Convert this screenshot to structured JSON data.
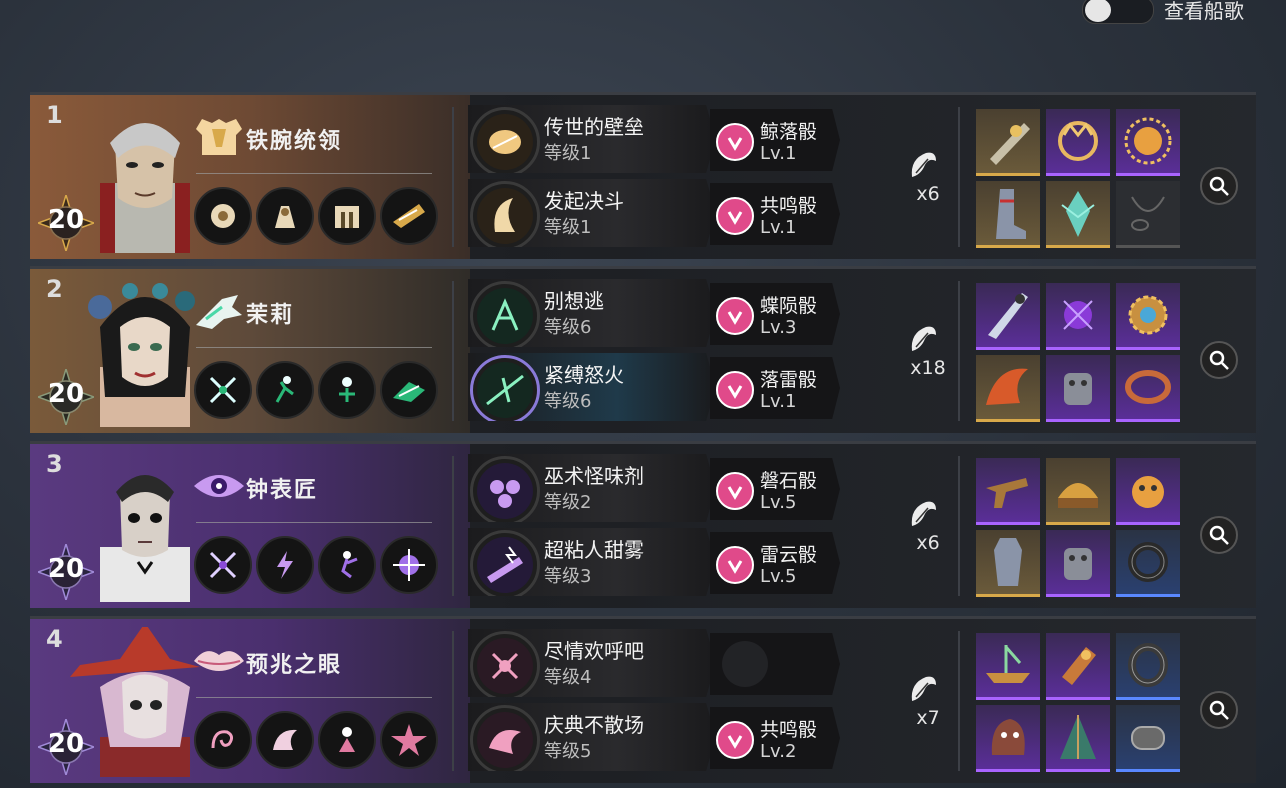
{
  "toggle": {
    "label": "查看船歌",
    "on": false
  },
  "rows": [
    {
      "rank": "1",
      "level": "20",
      "character": "铁腕统领",
      "theme": "brown",
      "skills": [
        {
          "name": "传世的壁垒",
          "level": "等级1"
        },
        {
          "name": "发起决斗",
          "level": "等级1"
        }
      ],
      "dice": [
        {
          "name": "鲸落骰",
          "level": "Lv.1"
        },
        {
          "name": "共鸣骰",
          "level": "Lv.1"
        }
      ],
      "count": "x6"
    },
    {
      "rank": "2",
      "level": "20",
      "character": "茉莉",
      "theme": "green",
      "skills": [
        {
          "name": "别想逃",
          "level": "等级6"
        },
        {
          "name": "紧缚怒火",
          "level": "等级6"
        }
      ],
      "dice": [
        {
          "name": "蝶陨骰",
          "level": "Lv.3"
        },
        {
          "name": "落雷骰",
          "level": "Lv.1"
        }
      ],
      "count": "x18"
    },
    {
      "rank": "3",
      "level": "20",
      "character": "钟表匠",
      "theme": "purple",
      "skills": [
        {
          "name": "巫术怪味剂",
          "level": "等级2"
        },
        {
          "name": "超粘人甜雾",
          "level": "等级3"
        }
      ],
      "dice": [
        {
          "name": "磐石骰",
          "level": "Lv.5"
        },
        {
          "name": "雷云骰",
          "level": "Lv.5"
        }
      ],
      "count": "x6"
    },
    {
      "rank": "4",
      "level": "20",
      "character": "预兆之眼",
      "theme": "purple",
      "skills": [
        {
          "name": "尽情欢呼吧",
          "level": "等级4"
        },
        {
          "name": "庆典不散场",
          "level": "等级5"
        }
      ],
      "dice": [
        {
          "name": "",
          "level": ""
        },
        {
          "name": "共鸣骰",
          "level": "Lv.2"
        }
      ],
      "count": "x7"
    }
  ],
  "colors": {
    "dice_accent": "#e04a8a",
    "item_gold": "#d8a94a",
    "item_purple": "#a964ff",
    "item_blue": "#5a88ff"
  }
}
